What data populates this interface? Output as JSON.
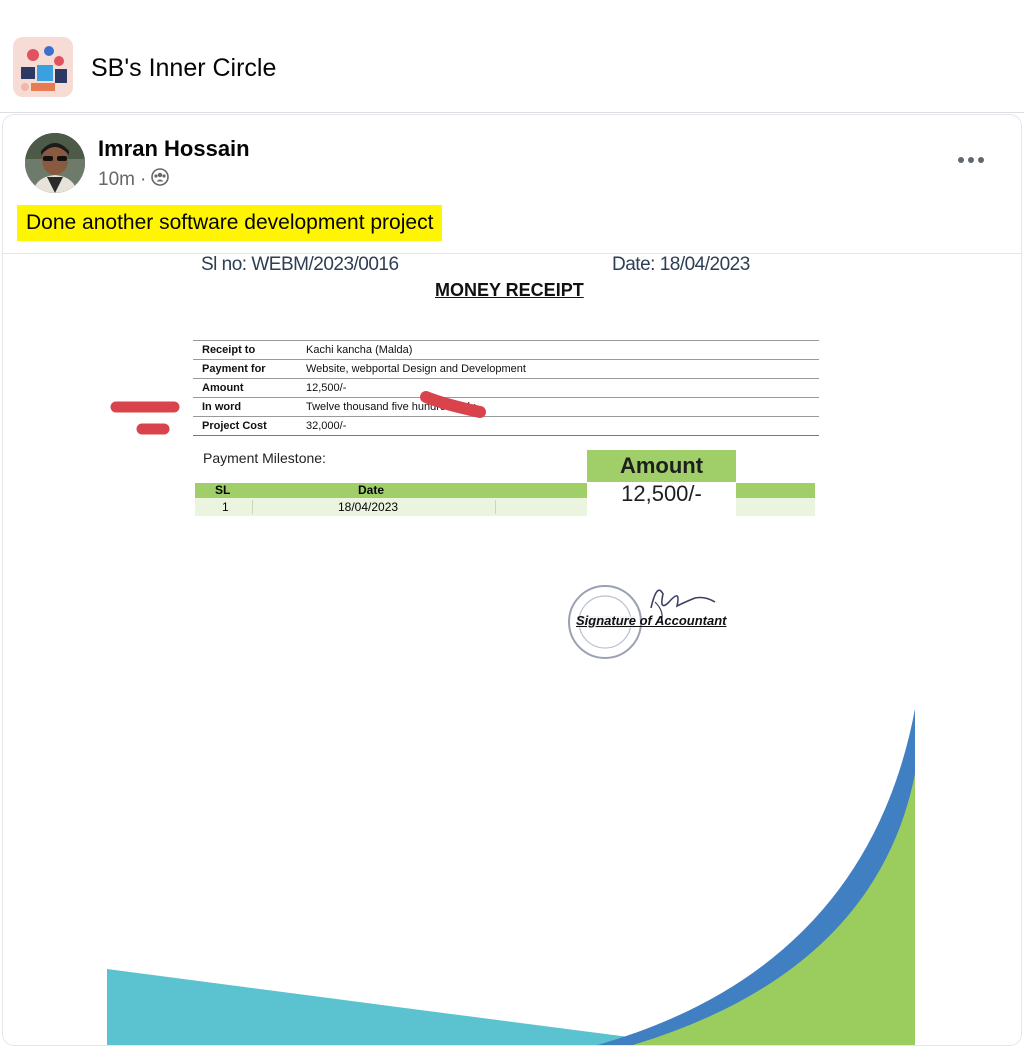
{
  "group": {
    "name": "SB's Inner Circle"
  },
  "post": {
    "author": "Imran Hossain",
    "time": "10m",
    "privacy_icon": "group-audience-icon",
    "text": "Done another software development project"
  },
  "receipt": {
    "sl_no": "Sl no: WEBM/2023/0016",
    "date": "Date: 18/04/2023",
    "title": "MONEY RECEIPT",
    "rows": [
      {
        "label": "Receipt to",
        "value": "Kachi kancha (Malda)"
      },
      {
        "label": "Payment for",
        "value": "Website, webportal Design and Development"
      },
      {
        "label": "Amount",
        "value": "12,500/-"
      },
      {
        "label": "In word",
        "value": "Twelve thousand five hundred only."
      },
      {
        "label": "Project Cost",
        "value": "32,000/-"
      }
    ],
    "milestone_label": "Payment Milestone:",
    "milestone_headers": {
      "sl": "SL",
      "date": "Date",
      "amount": "Amount"
    },
    "milestone_row": {
      "sl": "1",
      "date": "18/04/2023",
      "amount": "12,500/-"
    },
    "signature_label": "Signature of Accountant",
    "stamp_text": "AJAX Technology Balurghat",
    "colors": {
      "header_green": "#a0cf69",
      "row_green": "#ebf4df",
      "swoosh_blue": "#3f7fc2",
      "swoosh_green": "#9acd5e",
      "swoosh_teal": "#5bc3cf",
      "redaction_red": "#d9434b"
    }
  },
  "colors": {
    "highlight_yellow": "#fff500",
    "meta_gray": "#65676b"
  }
}
